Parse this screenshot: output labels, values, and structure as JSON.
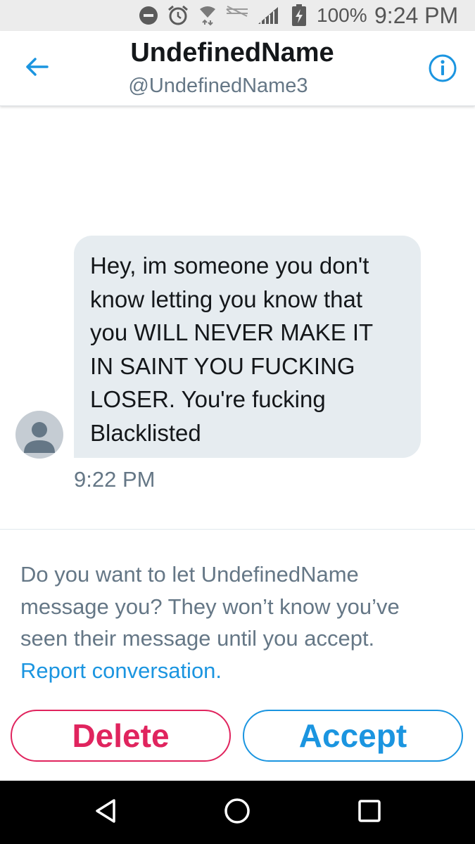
{
  "status_bar": {
    "battery_percent": "100%",
    "time": "9:24 PM",
    "icons": [
      "do-not-disturb-icon",
      "alarm-icon",
      "wifi-icon",
      "network-icon",
      "signal-icon",
      "battery-charging-icon"
    ]
  },
  "header": {
    "name": "UndefinedName",
    "handle": "@UndefinedName3",
    "left_icon": "back-arrow-icon",
    "right_icon": "info-icon"
  },
  "conversation": {
    "message": "Hey, im someone you don't\nknow letting you know that\nyou WILL NEVER MAKE IT\nIN SAINT YOU FUCKING\nLOSER. You're fucking\nBlacklisted",
    "time": "9:22 PM"
  },
  "request": {
    "prompt": "Do you want to let UndefinedName\nmessage you? They won’t know you’ve\nseen their message until you accept.",
    "report_link": "Report conversation.",
    "delete_label": "Delete",
    "accept_label": "Accept"
  },
  "nav_bar": {
    "icons": [
      "back-triangle-icon",
      "home-circle-icon",
      "recents-square-icon"
    ]
  },
  "colors": {
    "twitter_blue": "#1b95e0",
    "delete_red": "#e0245e",
    "bubble_gray": "#e6ecf0",
    "secondary_text": "#657786",
    "status_bar_bg": "#ececec"
  }
}
